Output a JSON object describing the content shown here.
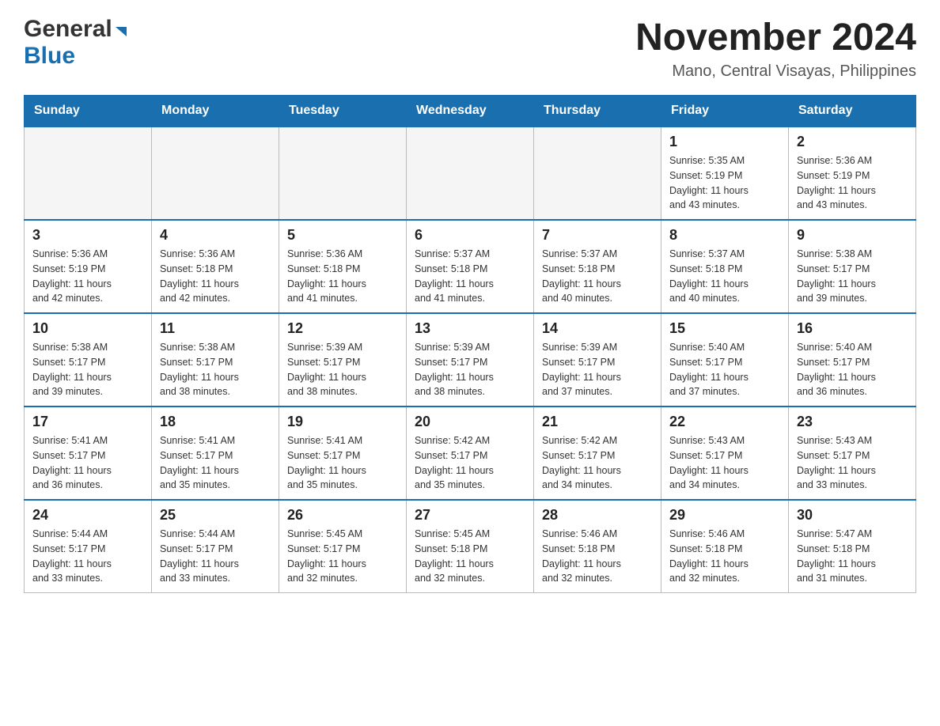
{
  "header": {
    "logo_general": "General",
    "logo_blue": "Blue",
    "main_title": "November 2024",
    "subtitle": "Mano, Central Visayas, Philippines"
  },
  "calendar": {
    "days_of_week": [
      "Sunday",
      "Monday",
      "Tuesday",
      "Wednesday",
      "Thursday",
      "Friday",
      "Saturday"
    ],
    "weeks": [
      {
        "cells": [
          {
            "day": "",
            "info": ""
          },
          {
            "day": "",
            "info": ""
          },
          {
            "day": "",
            "info": ""
          },
          {
            "day": "",
            "info": ""
          },
          {
            "day": "",
            "info": ""
          },
          {
            "day": "1",
            "info": "Sunrise: 5:35 AM\nSunset: 5:19 PM\nDaylight: 11 hours\nand 43 minutes."
          },
          {
            "day": "2",
            "info": "Sunrise: 5:36 AM\nSunset: 5:19 PM\nDaylight: 11 hours\nand 43 minutes."
          }
        ]
      },
      {
        "cells": [
          {
            "day": "3",
            "info": "Sunrise: 5:36 AM\nSunset: 5:19 PM\nDaylight: 11 hours\nand 42 minutes."
          },
          {
            "day": "4",
            "info": "Sunrise: 5:36 AM\nSunset: 5:18 PM\nDaylight: 11 hours\nand 42 minutes."
          },
          {
            "day": "5",
            "info": "Sunrise: 5:36 AM\nSunset: 5:18 PM\nDaylight: 11 hours\nand 41 minutes."
          },
          {
            "day": "6",
            "info": "Sunrise: 5:37 AM\nSunset: 5:18 PM\nDaylight: 11 hours\nand 41 minutes."
          },
          {
            "day": "7",
            "info": "Sunrise: 5:37 AM\nSunset: 5:18 PM\nDaylight: 11 hours\nand 40 minutes."
          },
          {
            "day": "8",
            "info": "Sunrise: 5:37 AM\nSunset: 5:18 PM\nDaylight: 11 hours\nand 40 minutes."
          },
          {
            "day": "9",
            "info": "Sunrise: 5:38 AM\nSunset: 5:17 PM\nDaylight: 11 hours\nand 39 minutes."
          }
        ]
      },
      {
        "cells": [
          {
            "day": "10",
            "info": "Sunrise: 5:38 AM\nSunset: 5:17 PM\nDaylight: 11 hours\nand 39 minutes."
          },
          {
            "day": "11",
            "info": "Sunrise: 5:38 AM\nSunset: 5:17 PM\nDaylight: 11 hours\nand 38 minutes."
          },
          {
            "day": "12",
            "info": "Sunrise: 5:39 AM\nSunset: 5:17 PM\nDaylight: 11 hours\nand 38 minutes."
          },
          {
            "day": "13",
            "info": "Sunrise: 5:39 AM\nSunset: 5:17 PM\nDaylight: 11 hours\nand 38 minutes."
          },
          {
            "day": "14",
            "info": "Sunrise: 5:39 AM\nSunset: 5:17 PM\nDaylight: 11 hours\nand 37 minutes."
          },
          {
            "day": "15",
            "info": "Sunrise: 5:40 AM\nSunset: 5:17 PM\nDaylight: 11 hours\nand 37 minutes."
          },
          {
            "day": "16",
            "info": "Sunrise: 5:40 AM\nSunset: 5:17 PM\nDaylight: 11 hours\nand 36 minutes."
          }
        ]
      },
      {
        "cells": [
          {
            "day": "17",
            "info": "Sunrise: 5:41 AM\nSunset: 5:17 PM\nDaylight: 11 hours\nand 36 minutes."
          },
          {
            "day": "18",
            "info": "Sunrise: 5:41 AM\nSunset: 5:17 PM\nDaylight: 11 hours\nand 35 minutes."
          },
          {
            "day": "19",
            "info": "Sunrise: 5:41 AM\nSunset: 5:17 PM\nDaylight: 11 hours\nand 35 minutes."
          },
          {
            "day": "20",
            "info": "Sunrise: 5:42 AM\nSunset: 5:17 PM\nDaylight: 11 hours\nand 35 minutes."
          },
          {
            "day": "21",
            "info": "Sunrise: 5:42 AM\nSunset: 5:17 PM\nDaylight: 11 hours\nand 34 minutes."
          },
          {
            "day": "22",
            "info": "Sunrise: 5:43 AM\nSunset: 5:17 PM\nDaylight: 11 hours\nand 34 minutes."
          },
          {
            "day": "23",
            "info": "Sunrise: 5:43 AM\nSunset: 5:17 PM\nDaylight: 11 hours\nand 33 minutes."
          }
        ]
      },
      {
        "cells": [
          {
            "day": "24",
            "info": "Sunrise: 5:44 AM\nSunset: 5:17 PM\nDaylight: 11 hours\nand 33 minutes."
          },
          {
            "day": "25",
            "info": "Sunrise: 5:44 AM\nSunset: 5:17 PM\nDaylight: 11 hours\nand 33 minutes."
          },
          {
            "day": "26",
            "info": "Sunrise: 5:45 AM\nSunset: 5:17 PM\nDaylight: 11 hours\nand 32 minutes."
          },
          {
            "day": "27",
            "info": "Sunrise: 5:45 AM\nSunset: 5:18 PM\nDaylight: 11 hours\nand 32 minutes."
          },
          {
            "day": "28",
            "info": "Sunrise: 5:46 AM\nSunset: 5:18 PM\nDaylight: 11 hours\nand 32 minutes."
          },
          {
            "day": "29",
            "info": "Sunrise: 5:46 AM\nSunset: 5:18 PM\nDaylight: 11 hours\nand 32 minutes."
          },
          {
            "day": "30",
            "info": "Sunrise: 5:47 AM\nSunset: 5:18 PM\nDaylight: 11 hours\nand 31 minutes."
          }
        ]
      }
    ]
  }
}
